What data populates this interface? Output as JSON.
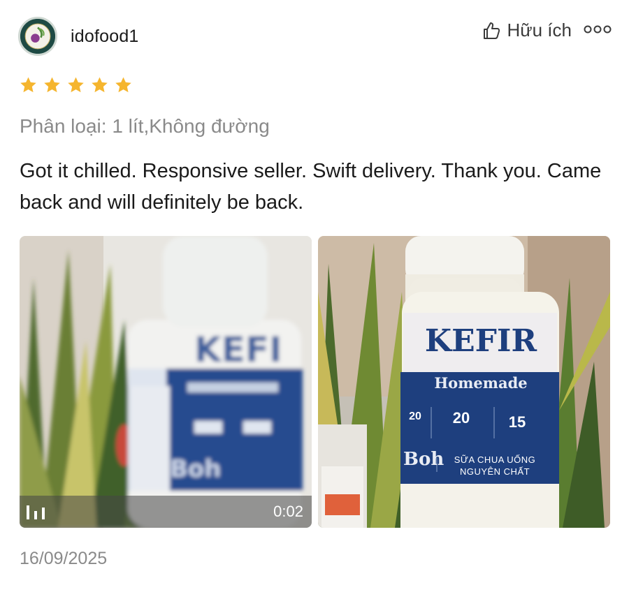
{
  "review": {
    "username": "idofood1",
    "helpful_label": "Hữu ích",
    "rating": 5,
    "rating_max": 5,
    "variant": "Phân loại: 1 lít,Không đường",
    "comment": "Got it chilled.  Responsive seller.  Swift delivery. Thank you. Came back and will definitely be back.",
    "date": "16/09/2025"
  },
  "media": {
    "video": {
      "duration": "0:02"
    },
    "product_label": {
      "brand": "KEFIR",
      "subtitle": "Homemade",
      "maker": "Boh",
      "stat_1": "20",
      "stat_2": "20",
      "stat_3": "15",
      "line_1": "SỮA CHUA UỐNG",
      "line_2": "NGUYÊN CHẤT"
    }
  },
  "colors": {
    "star": "#F5B52E",
    "label_blue": "#1E3F7E",
    "muted_text": "#8a8a8a"
  },
  "icons": {
    "helpful": "thumbs-up-icon",
    "more": "more-options-icon",
    "video": "video-bars-icon"
  }
}
